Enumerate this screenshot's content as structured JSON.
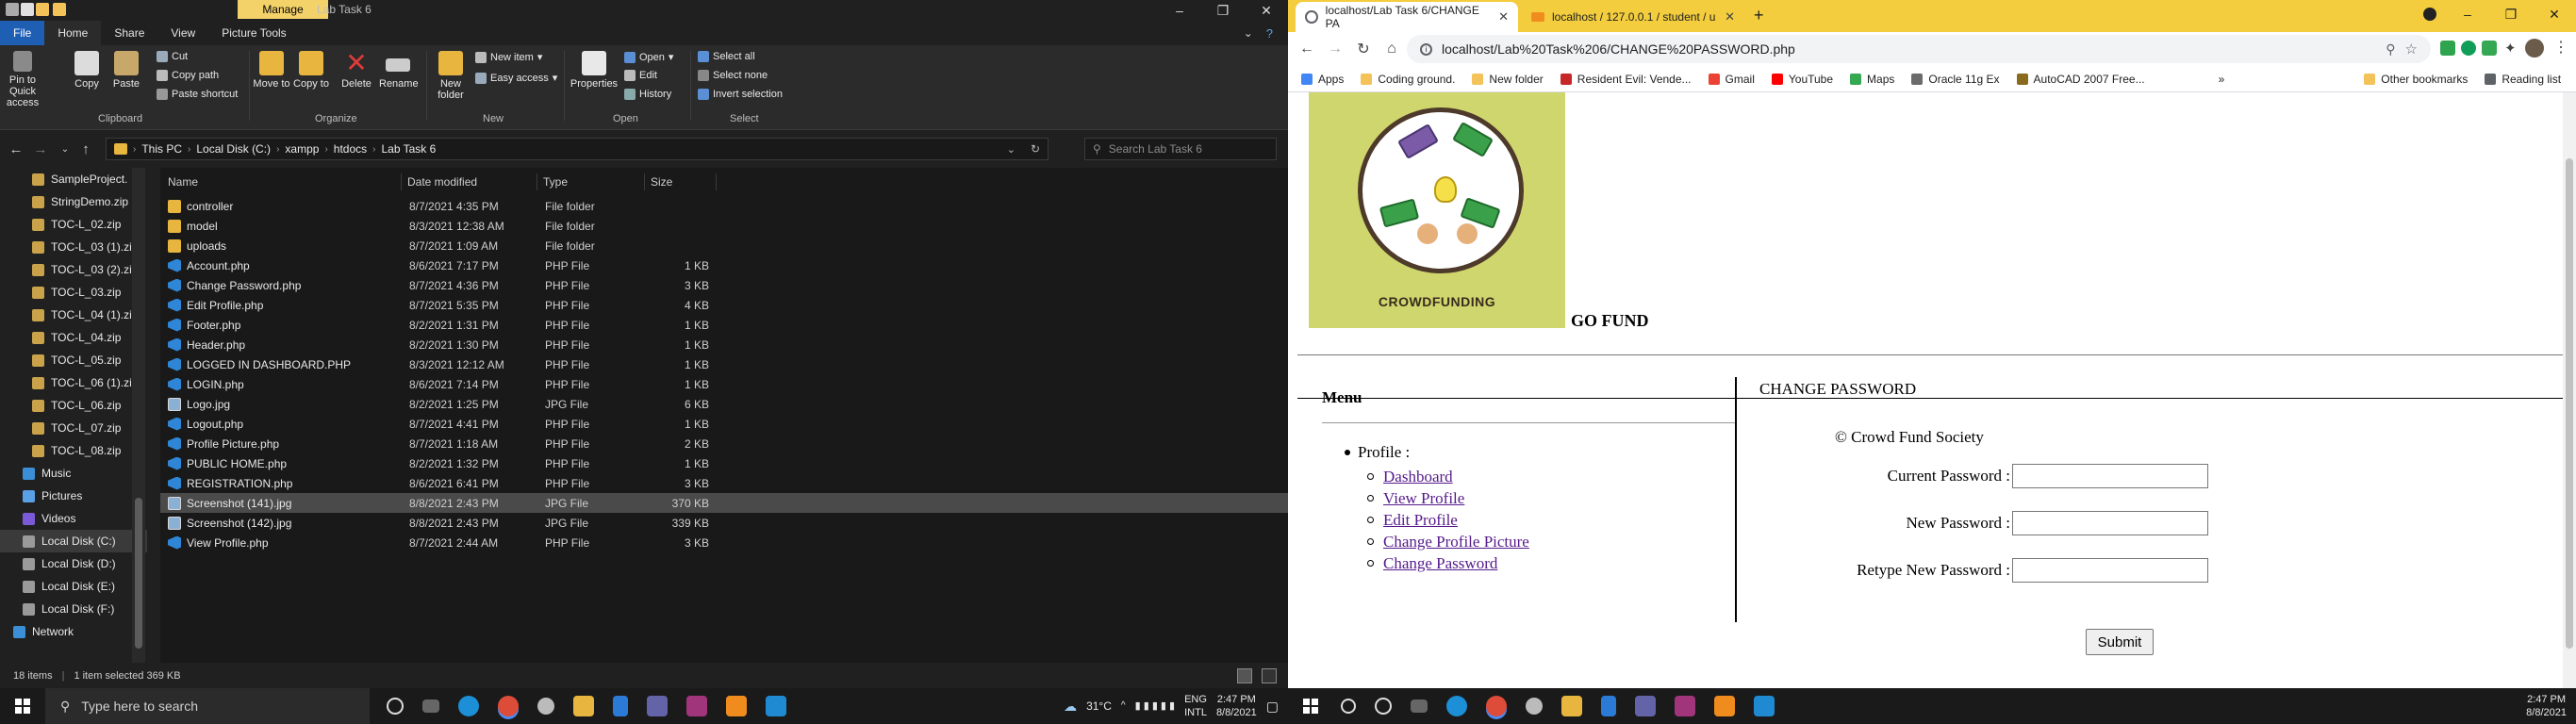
{
  "explorer": {
    "title": "Lab Task 6",
    "manage_tab": "Manage",
    "tabs": [
      "File",
      "Home",
      "Share",
      "View",
      "Picture Tools"
    ],
    "ribbon": {
      "clipboard": {
        "label": "Clipboard",
        "pin": "Pin to Quick access",
        "copy": "Copy",
        "paste": "Paste",
        "cut": "Cut",
        "copy_path": "Copy path",
        "paste_shortcut": "Paste shortcut"
      },
      "organize": {
        "label": "Organize",
        "move_to": "Move to",
        "copy_to": "Copy to",
        "delete": "Delete",
        "rename": "Rename"
      },
      "new": {
        "label": "New",
        "new_folder": "New folder",
        "new_item": "New item",
        "easy_access": "Easy access"
      },
      "open": {
        "label": "Open",
        "properties": "Properties",
        "open": "Open",
        "edit": "Edit",
        "history": "History"
      },
      "select": {
        "label": "Select",
        "select_all": "Select all",
        "select_none": "Select none",
        "invert": "Invert selection"
      }
    },
    "breadcrumb": [
      "This PC",
      "Local Disk (C:)",
      "xampp",
      "htdocs",
      "Lab Task 6"
    ],
    "search_placeholder": "Search Lab Task 6",
    "nav_items": [
      "SampleProject.",
      "StringDemo.zip",
      "TOC-L_02.zip",
      "TOC-L_03 (1).zi",
      "TOC-L_03 (2).zi",
      "TOC-L_03.zip",
      "TOC-L_04 (1).zi",
      "TOC-L_04.zip",
      "TOC-L_05.zip",
      "TOC-L_06 (1).zi",
      "TOC-L_06.zip",
      "TOC-L_07.zip",
      "TOC-L_08.zip",
      "Music",
      "Pictures",
      "Videos",
      "Local Disk (C:)",
      "Local Disk (D:)",
      "Local Disk (E:)",
      "Local Disk (F:)",
      "Network"
    ],
    "columns": [
      "Name",
      "Date modified",
      "Type",
      "Size"
    ],
    "files": [
      {
        "name": "controller",
        "date": "8/7/2021 4:35 PM",
        "type": "File folder",
        "size": "",
        "kind": "folder"
      },
      {
        "name": "model",
        "date": "8/3/2021 12:38 AM",
        "type": "File folder",
        "size": "",
        "kind": "folder"
      },
      {
        "name": "uploads",
        "date": "8/7/2021 1:09 AM",
        "type": "File folder",
        "size": "",
        "kind": "folder"
      },
      {
        "name": "Account.php",
        "date": "8/6/2021 7:17 PM",
        "type": "PHP File",
        "size": "1 KB",
        "kind": "php"
      },
      {
        "name": "Change Password.php",
        "date": "8/7/2021 4:36 PM",
        "type": "PHP File",
        "size": "3 KB",
        "kind": "php"
      },
      {
        "name": "Edit Profile.php",
        "date": "8/7/2021 5:35 PM",
        "type": "PHP File",
        "size": "4 KB",
        "kind": "php"
      },
      {
        "name": "Footer.php",
        "date": "8/2/2021 1:31 PM",
        "type": "PHP File",
        "size": "1 KB",
        "kind": "php"
      },
      {
        "name": "Header.php",
        "date": "8/2/2021 1:30 PM",
        "type": "PHP File",
        "size": "1 KB",
        "kind": "php"
      },
      {
        "name": "LOGGED IN DASHBOARD.PHP",
        "date": "8/3/2021 12:12 AM",
        "type": "PHP File",
        "size": "1 KB",
        "kind": "php"
      },
      {
        "name": "LOGIN.php",
        "date": "8/6/2021 7:14 PM",
        "type": "PHP File",
        "size": "1 KB",
        "kind": "php"
      },
      {
        "name": "Logo.jpg",
        "date": "8/2/2021 1:25 PM",
        "type": "JPG File",
        "size": "6 KB",
        "kind": "jpg"
      },
      {
        "name": "Logout.php",
        "date": "8/7/2021 4:41 PM",
        "type": "PHP File",
        "size": "1 KB",
        "kind": "php"
      },
      {
        "name": "Profile Picture.php",
        "date": "8/7/2021 1:18 AM",
        "type": "PHP File",
        "size": "2 KB",
        "kind": "php"
      },
      {
        "name": "PUBLIC HOME.php",
        "date": "8/2/2021 1:32 PM",
        "type": "PHP File",
        "size": "1 KB",
        "kind": "php"
      },
      {
        "name": "REGISTRATION.php",
        "date": "8/6/2021 6:41 PM",
        "type": "PHP File",
        "size": "3 KB",
        "kind": "php"
      },
      {
        "name": "Screenshot (141).jpg",
        "date": "8/8/2021 2:43 PM",
        "type": "JPG File",
        "size": "370 KB",
        "kind": "jpg",
        "selected": true
      },
      {
        "name": "Screenshot (142).jpg",
        "date": "8/8/2021 2:43 PM",
        "type": "JPG File",
        "size": "339 KB",
        "kind": "jpg"
      },
      {
        "name": "View Profile.php",
        "date": "8/7/2021 2:44 AM",
        "type": "PHP File",
        "size": "3 KB",
        "kind": "php"
      }
    ],
    "status": {
      "count": "18 items",
      "selected": "1 item selected  369 KB"
    }
  },
  "browser": {
    "tabs": [
      {
        "title": "localhost/Lab Task 6/CHANGE PA"
      },
      {
        "title": "localhost / 127.0.0.1 / student / u"
      }
    ],
    "url": "localhost/Lab%20Task%206/CHANGE%20PASSWORD.php",
    "bookmarks": [
      "Apps",
      "Coding ground.",
      "New folder",
      "Resident Evil: Vende...",
      "Gmail",
      "YouTube",
      "Maps",
      "Oracle 11g Ex",
      "AutoCAD 2007 Free...",
      "Other bookmarks",
      "Reading list"
    ],
    "page": {
      "logo_text": "CROWDFUNDING",
      "site_name": "GO FUND",
      "menu_title": "Menu",
      "profile_label": "Profile :",
      "links": [
        "Dashboard",
        "View Profile",
        "Edit Profile",
        "Change Profile Picture",
        "Change Password"
      ],
      "section_title": "CHANGE PASSWORD",
      "copyright": "© Crowd Fund Society",
      "fields": [
        {
          "label": "Current Password :",
          "value": ""
        },
        {
          "label": "New Password :",
          "value": ""
        },
        {
          "label": "Retype New Password :",
          "value": ""
        }
      ],
      "submit": "Submit"
    }
  },
  "taskbar": {
    "search_placeholder": "Type here to search",
    "weather": "31°C",
    "lang": "ENG",
    "lang_sub": "INTL",
    "time_left": "2:47 PM",
    "date_left": "8/8/2021",
    "time_right": "2:47 PM",
    "date_right": "8/8/2021"
  },
  "colors": {
    "explorer_bg": "#202020",
    "chrome_tabstrip": "#f3cd3d",
    "manage_tab": "#f4d26a",
    "link_visited": "#551a8b",
    "file_tab": "#1e5fb4"
  }
}
